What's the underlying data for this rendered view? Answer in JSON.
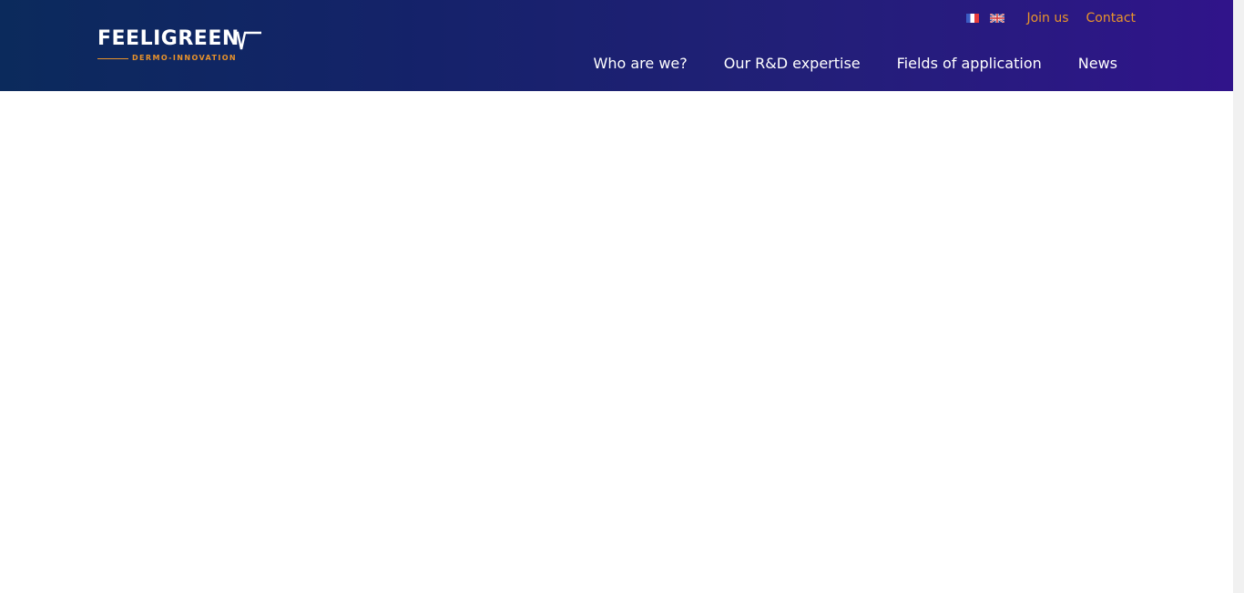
{
  "brand": {
    "name": "FEELIGREEN",
    "tagline": "DERMO-INNOVATION",
    "primary_color": "#1a2468",
    "accent_color": "#e9942b"
  },
  "topbar": {
    "languages": [
      {
        "name": "french-flag-icon",
        "code": "fr"
      },
      {
        "name": "english-flag-icon",
        "code": "en"
      }
    ],
    "links": [
      "Join us",
      "Contact"
    ]
  },
  "nav": {
    "items": [
      "Who are we?",
      "Our R&D expertise",
      "Fields of application",
      "News"
    ]
  }
}
